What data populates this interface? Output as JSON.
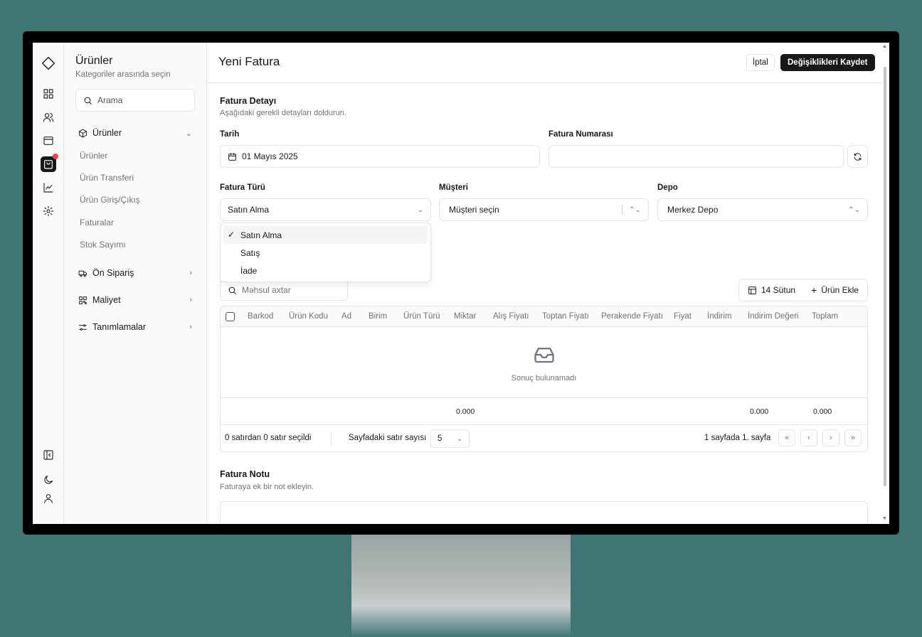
{
  "sidebar": {
    "title": "Ürünler",
    "subtitle": "Kategoriler arasında seçin",
    "search_placeholder": "Arama",
    "groups": [
      {
        "label": "Ürünler",
        "items": [
          "Ürünler",
          "Ürün Transferi",
          "Ürün Giriş/Çıkış",
          "Faturalar",
          "Stok Sayımı"
        ]
      },
      {
        "label": "Ön Sipariş"
      },
      {
        "label": "Maliyet"
      },
      {
        "label": "Tanımlamalar"
      }
    ]
  },
  "header": {
    "title": "Yeni Fatura",
    "cancel_label": "İptal",
    "save_label": "Değişiklikleri Kaydet"
  },
  "invoice_detail": {
    "title": "Fatura Detayı",
    "description": "Aşağıdaki gerekli detayları doldurun.",
    "date_label": "Tarih",
    "date_value": "01 Mayıs 2025",
    "number_label": "Fatura Numarası",
    "number_value": "",
    "type_label": "Fatura Türü",
    "type_value": "Satın Alma",
    "customer_label": "Müşteri",
    "customer_placeholder": "Müşteri seçin",
    "warehouse_label": "Depo",
    "warehouse_value": "Merkez Depo"
  },
  "type_options": [
    "Satın Alma",
    "Satış",
    "İade"
  ],
  "table": {
    "search_placeholder": "Məhsul axtar",
    "columns_button": "14 Sütun",
    "add_button": "Ürün Ekle",
    "columns": [
      "Barkod",
      "Ürün Kodu",
      "Ad",
      "Birim",
      "Ürün Türü",
      "Miktar",
      "Alış Fiyatı",
      "Toptan Fiyatı",
      "Perakende Fiyatı",
      "Fiyat",
      "İndirim",
      "İndirim Değeri",
      "Toplam"
    ],
    "empty_text": "Sonuç bulunamadı",
    "totals": {
      "miktar": "0.000",
      "indirim_degeri": "0.000",
      "toplam": "0.000"
    },
    "selection_text": "0 satırdan 0 satır seçildi",
    "rows_per_page_label": "Sayfadaki satır sayısı",
    "rows_per_page_value": "5",
    "page_text": "1 sayfada 1. sayfa"
  },
  "invoice_note": {
    "title": "Fatura Notu",
    "description": "Faturaya ek bir not ekleyin."
  }
}
